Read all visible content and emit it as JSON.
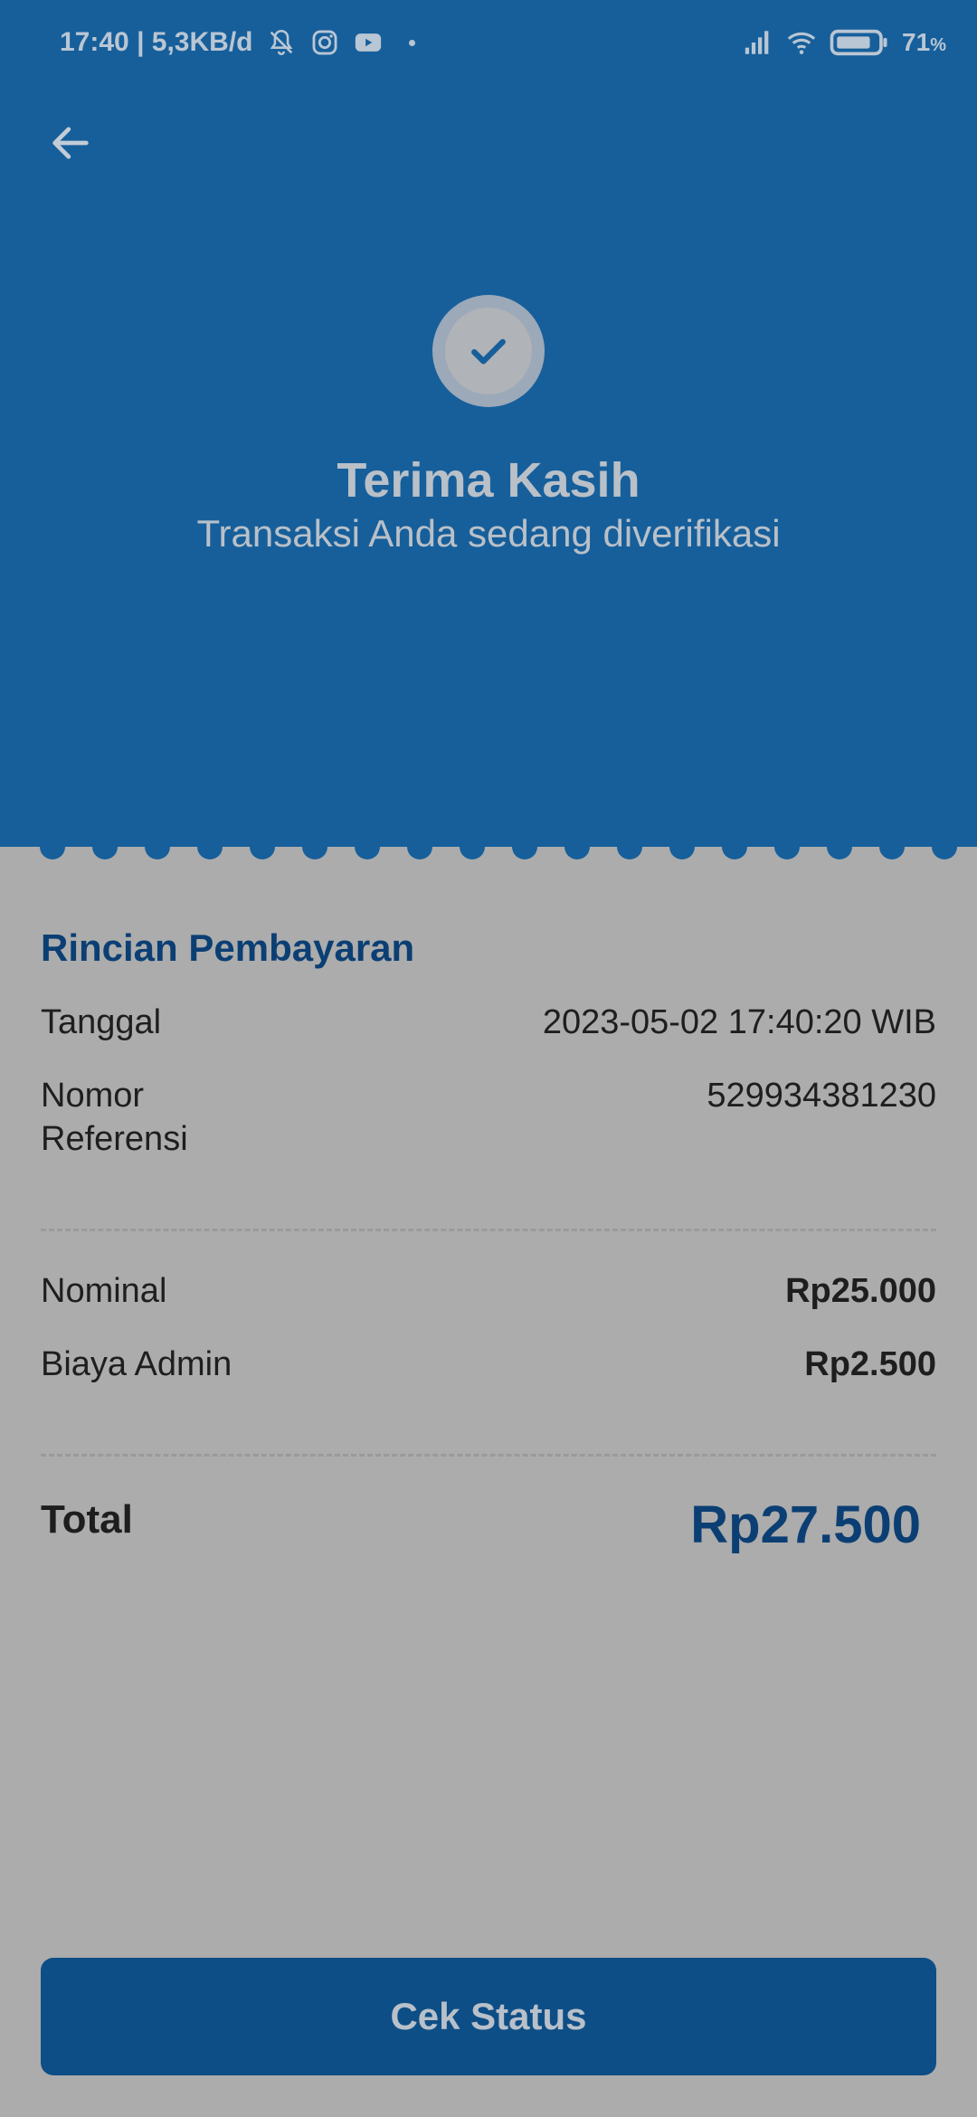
{
  "status_bar": {
    "time_info": "17:40 | 5,3KB/d",
    "battery_pct": "71",
    "battery_unit": "%"
  },
  "header": {
    "title": "Terima Kasih",
    "subtitle": "Transaksi Anda sedang diverifikasi"
  },
  "details": {
    "section_title": "Rincian Pembayaran",
    "date_label": "Tanggal",
    "date_value": "2023-05-02 17:40:20 WIB",
    "ref_label_line1": "Nomor",
    "ref_label_line2": "Referensi",
    "ref_value": "529934381230",
    "nominal_label": "Nominal",
    "nominal_value": "Rp25.000",
    "admin_label": "Biaya Admin",
    "admin_value": "Rp2.500",
    "total_label": "Total",
    "total_value": "Rp27.500"
  },
  "actions": {
    "check_status": "Cek Status"
  },
  "colors": {
    "header_bg": "#165f9b",
    "page_bg": "#acacac",
    "accent_text": "#0b3f74",
    "button_bg": "#0e4e86"
  }
}
